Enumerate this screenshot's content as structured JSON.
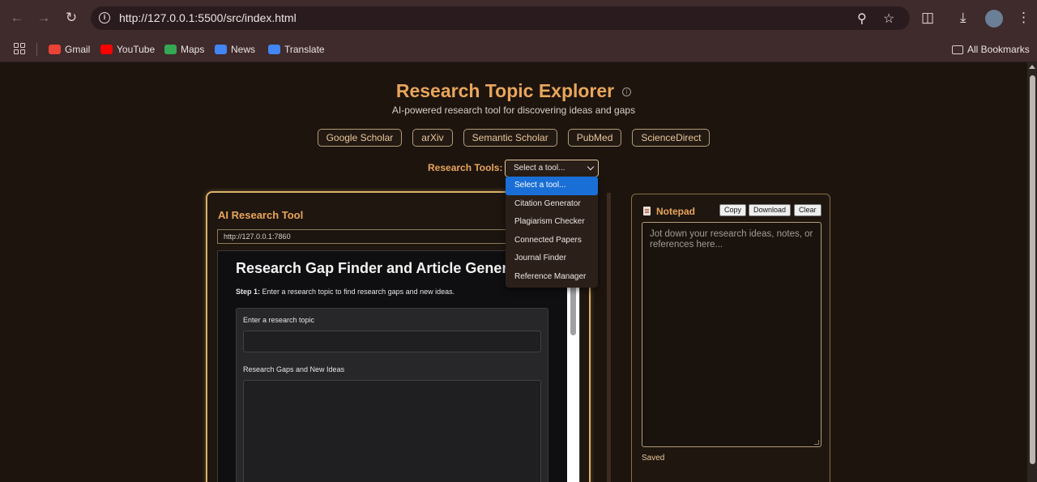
{
  "browser": {
    "url": "http://127.0.0.1:5500/src/index.html",
    "bookmarks": [
      {
        "label": "Gmail",
        "color": "#ea4335"
      },
      {
        "label": "YouTube",
        "color": "#ff0000"
      },
      {
        "label": "Maps",
        "color": "#34a853"
      },
      {
        "label": "News",
        "color": "#4285f4"
      },
      {
        "label": "Translate",
        "color": "#4285f4"
      }
    ],
    "all_bookmarks": "All Bookmarks"
  },
  "header": {
    "title": "Research Topic Explorer",
    "subtitle": "AI-powered research tool for discovering ideas and gaps"
  },
  "links": [
    "Google Scholar",
    "arXiv",
    "Semantic Scholar",
    "PubMed",
    "ScienceDirect"
  ],
  "research_tools": {
    "label": "Research Tools:",
    "selected": "Select a tool...",
    "options": [
      "Select a tool...",
      "Citation Generator",
      "Plagiarism Checker",
      "Connected Papers",
      "Journal Finder",
      "Reference Manager"
    ]
  },
  "tool_panel": {
    "title": "AI Research Tool",
    "url": "http://127.0.0.1:7860",
    "app": {
      "title": "Research Gap Finder and Article Generator",
      "step_label": "Step 1:",
      "step_text": " Enter a research topic to find research gaps and new ideas.",
      "topic_label": "Enter a research topic",
      "gaps_label": "Research Gaps and New Ideas"
    }
  },
  "notepad": {
    "title": "Notepad",
    "copy": "Copy",
    "download": "Download",
    "clear": "Clear",
    "placeholder": "Jot down your research ideas, notes, or references here...",
    "status": "Saved"
  },
  "colors": {
    "accent": "#e8a65b",
    "background": "#1d140e",
    "selected_option": "#1a6fd6"
  }
}
